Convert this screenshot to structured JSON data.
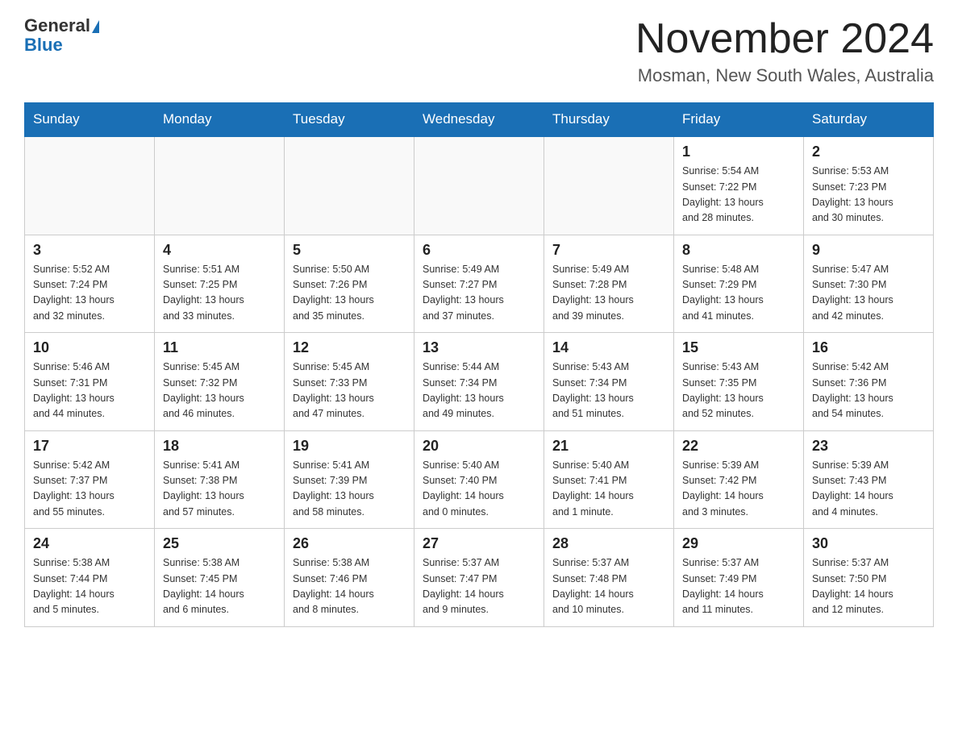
{
  "header": {
    "logo_line1": "General",
    "logo_line2": "Blue",
    "title": "November 2024",
    "subtitle": "Mosman, New South Wales, Australia"
  },
  "days_of_week": [
    "Sunday",
    "Monday",
    "Tuesday",
    "Wednesday",
    "Thursday",
    "Friday",
    "Saturday"
  ],
  "weeks": [
    [
      {
        "day": "",
        "info": ""
      },
      {
        "day": "",
        "info": ""
      },
      {
        "day": "",
        "info": ""
      },
      {
        "day": "",
        "info": ""
      },
      {
        "day": "",
        "info": ""
      },
      {
        "day": "1",
        "info": "Sunrise: 5:54 AM\nSunset: 7:22 PM\nDaylight: 13 hours\nand 28 minutes."
      },
      {
        "day": "2",
        "info": "Sunrise: 5:53 AM\nSunset: 7:23 PM\nDaylight: 13 hours\nand 30 minutes."
      }
    ],
    [
      {
        "day": "3",
        "info": "Sunrise: 5:52 AM\nSunset: 7:24 PM\nDaylight: 13 hours\nand 32 minutes."
      },
      {
        "day": "4",
        "info": "Sunrise: 5:51 AM\nSunset: 7:25 PM\nDaylight: 13 hours\nand 33 minutes."
      },
      {
        "day": "5",
        "info": "Sunrise: 5:50 AM\nSunset: 7:26 PM\nDaylight: 13 hours\nand 35 minutes."
      },
      {
        "day": "6",
        "info": "Sunrise: 5:49 AM\nSunset: 7:27 PM\nDaylight: 13 hours\nand 37 minutes."
      },
      {
        "day": "7",
        "info": "Sunrise: 5:49 AM\nSunset: 7:28 PM\nDaylight: 13 hours\nand 39 minutes."
      },
      {
        "day": "8",
        "info": "Sunrise: 5:48 AM\nSunset: 7:29 PM\nDaylight: 13 hours\nand 41 minutes."
      },
      {
        "day": "9",
        "info": "Sunrise: 5:47 AM\nSunset: 7:30 PM\nDaylight: 13 hours\nand 42 minutes."
      }
    ],
    [
      {
        "day": "10",
        "info": "Sunrise: 5:46 AM\nSunset: 7:31 PM\nDaylight: 13 hours\nand 44 minutes."
      },
      {
        "day": "11",
        "info": "Sunrise: 5:45 AM\nSunset: 7:32 PM\nDaylight: 13 hours\nand 46 minutes."
      },
      {
        "day": "12",
        "info": "Sunrise: 5:45 AM\nSunset: 7:33 PM\nDaylight: 13 hours\nand 47 minutes."
      },
      {
        "day": "13",
        "info": "Sunrise: 5:44 AM\nSunset: 7:34 PM\nDaylight: 13 hours\nand 49 minutes."
      },
      {
        "day": "14",
        "info": "Sunrise: 5:43 AM\nSunset: 7:34 PM\nDaylight: 13 hours\nand 51 minutes."
      },
      {
        "day": "15",
        "info": "Sunrise: 5:43 AM\nSunset: 7:35 PM\nDaylight: 13 hours\nand 52 minutes."
      },
      {
        "day": "16",
        "info": "Sunrise: 5:42 AM\nSunset: 7:36 PM\nDaylight: 13 hours\nand 54 minutes."
      }
    ],
    [
      {
        "day": "17",
        "info": "Sunrise: 5:42 AM\nSunset: 7:37 PM\nDaylight: 13 hours\nand 55 minutes."
      },
      {
        "day": "18",
        "info": "Sunrise: 5:41 AM\nSunset: 7:38 PM\nDaylight: 13 hours\nand 57 minutes."
      },
      {
        "day": "19",
        "info": "Sunrise: 5:41 AM\nSunset: 7:39 PM\nDaylight: 13 hours\nand 58 minutes."
      },
      {
        "day": "20",
        "info": "Sunrise: 5:40 AM\nSunset: 7:40 PM\nDaylight: 14 hours\nand 0 minutes."
      },
      {
        "day": "21",
        "info": "Sunrise: 5:40 AM\nSunset: 7:41 PM\nDaylight: 14 hours\nand 1 minute."
      },
      {
        "day": "22",
        "info": "Sunrise: 5:39 AM\nSunset: 7:42 PM\nDaylight: 14 hours\nand 3 minutes."
      },
      {
        "day": "23",
        "info": "Sunrise: 5:39 AM\nSunset: 7:43 PM\nDaylight: 14 hours\nand 4 minutes."
      }
    ],
    [
      {
        "day": "24",
        "info": "Sunrise: 5:38 AM\nSunset: 7:44 PM\nDaylight: 14 hours\nand 5 minutes."
      },
      {
        "day": "25",
        "info": "Sunrise: 5:38 AM\nSunset: 7:45 PM\nDaylight: 14 hours\nand 6 minutes."
      },
      {
        "day": "26",
        "info": "Sunrise: 5:38 AM\nSunset: 7:46 PM\nDaylight: 14 hours\nand 8 minutes."
      },
      {
        "day": "27",
        "info": "Sunrise: 5:37 AM\nSunset: 7:47 PM\nDaylight: 14 hours\nand 9 minutes."
      },
      {
        "day": "28",
        "info": "Sunrise: 5:37 AM\nSunset: 7:48 PM\nDaylight: 14 hours\nand 10 minutes."
      },
      {
        "day": "29",
        "info": "Sunrise: 5:37 AM\nSunset: 7:49 PM\nDaylight: 14 hours\nand 11 minutes."
      },
      {
        "day": "30",
        "info": "Sunrise: 5:37 AM\nSunset: 7:50 PM\nDaylight: 14 hours\nand 12 minutes."
      }
    ]
  ]
}
